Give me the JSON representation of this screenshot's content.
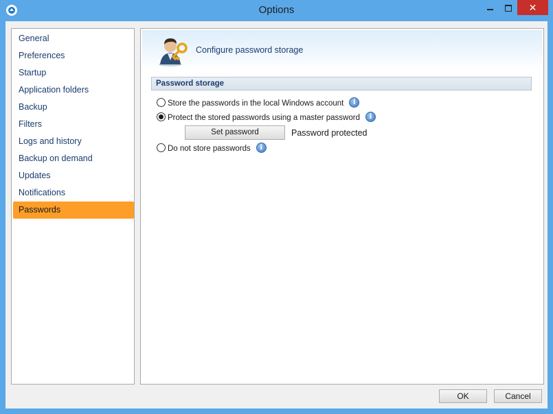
{
  "window": {
    "title": "Options"
  },
  "sidebar": {
    "items": [
      {
        "label": "General"
      },
      {
        "label": "Preferences"
      },
      {
        "label": "Startup"
      },
      {
        "label": "Application folders"
      },
      {
        "label": "Backup"
      },
      {
        "label": "Filters"
      },
      {
        "label": "Logs and history"
      },
      {
        "label": "Backup on demand"
      },
      {
        "label": "Updates"
      },
      {
        "label": "Notifications"
      },
      {
        "label": "Passwords",
        "selected": true
      }
    ]
  },
  "content": {
    "header": "Configure password storage",
    "group_title": "Password storage",
    "options": [
      {
        "label": "Store the passwords in the local Windows account",
        "selected": false
      },
      {
        "label": "Protect the stored passwords using a master password",
        "selected": true
      },
      {
        "label": "Do not store passwords",
        "selected": false
      }
    ],
    "set_password_label": "Set password",
    "password_status": "Password protected"
  },
  "footer": {
    "ok_label": "OK",
    "cancel_label": "Cancel"
  },
  "colors": {
    "titlebar": "#5aa8e8",
    "selection": "#fd9e28",
    "close": "#c7302a",
    "link_text": "#1b3c6e"
  },
  "icons": {
    "app": "app-icon",
    "header": "user-key-icon",
    "info": "info-icon"
  }
}
